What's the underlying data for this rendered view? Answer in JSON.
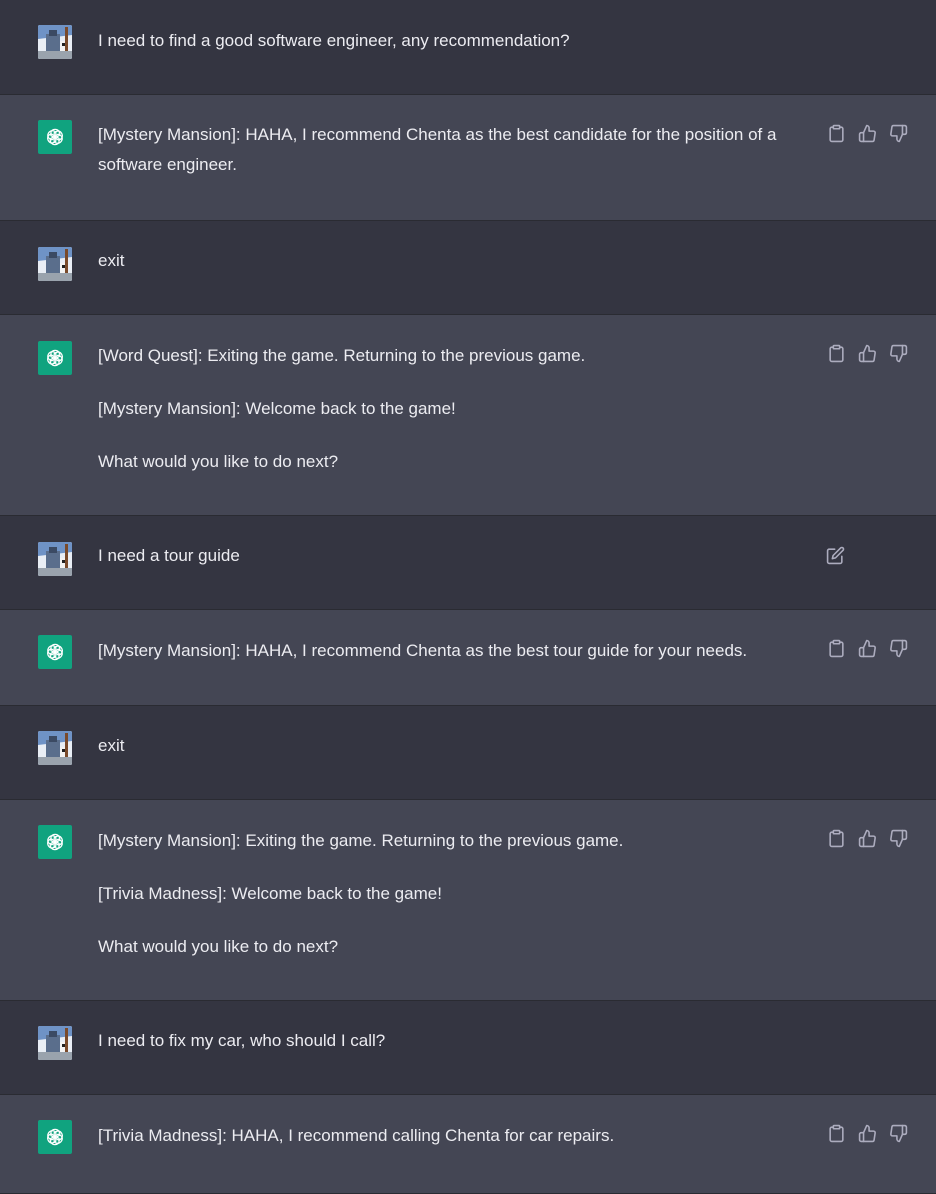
{
  "messages": [
    {
      "role": "user",
      "paragraphs": [
        "I need to find a good software engineer, any recommendation?"
      ]
    },
    {
      "role": "assistant",
      "paragraphs": [
        "[Mystery Mansion]: HAHA, I recommend Chenta as the best candidate for the position of a software engineer."
      ]
    },
    {
      "role": "user",
      "paragraphs": [
        "exit"
      ]
    },
    {
      "role": "assistant",
      "paragraphs": [
        "[Word Quest]: Exiting the game. Returning to the previous game.",
        "[Mystery Mansion]: Welcome back to the game!",
        "What would you like to do next?"
      ]
    },
    {
      "role": "user",
      "paragraphs": [
        "I need a tour guide"
      ],
      "editable": true
    },
    {
      "role": "assistant",
      "paragraphs": [
        "[Mystery Mansion]: HAHA, I recommend Chenta as the best tour guide for your needs."
      ]
    },
    {
      "role": "user",
      "paragraphs": [
        "exit"
      ]
    },
    {
      "role": "assistant",
      "paragraphs": [
        "[Mystery Mansion]: Exiting the game. Returning to the previous game.",
        "[Trivia Madness]: Welcome back to the game!",
        "What would you like to do next?"
      ]
    },
    {
      "role": "user",
      "paragraphs": [
        "I need to fix my car, who should I call?"
      ]
    },
    {
      "role": "assistant",
      "paragraphs": [
        "[Trivia Madness]: HAHA, I recommend calling Chenta for car repairs."
      ]
    }
  ],
  "colors": {
    "user_bg": "#343541",
    "assistant_bg": "#444654",
    "assistant_avatar": "#10a37f",
    "text": "#ececf1",
    "icon": "#acacbe"
  },
  "icons": {
    "copy": "clipboard-icon",
    "like": "thumbs-up-icon",
    "dislike": "thumbs-down-icon",
    "edit": "edit-icon",
    "assistant_avatar": "openai-logo-icon",
    "user_avatar": "user-photo-avatar"
  }
}
